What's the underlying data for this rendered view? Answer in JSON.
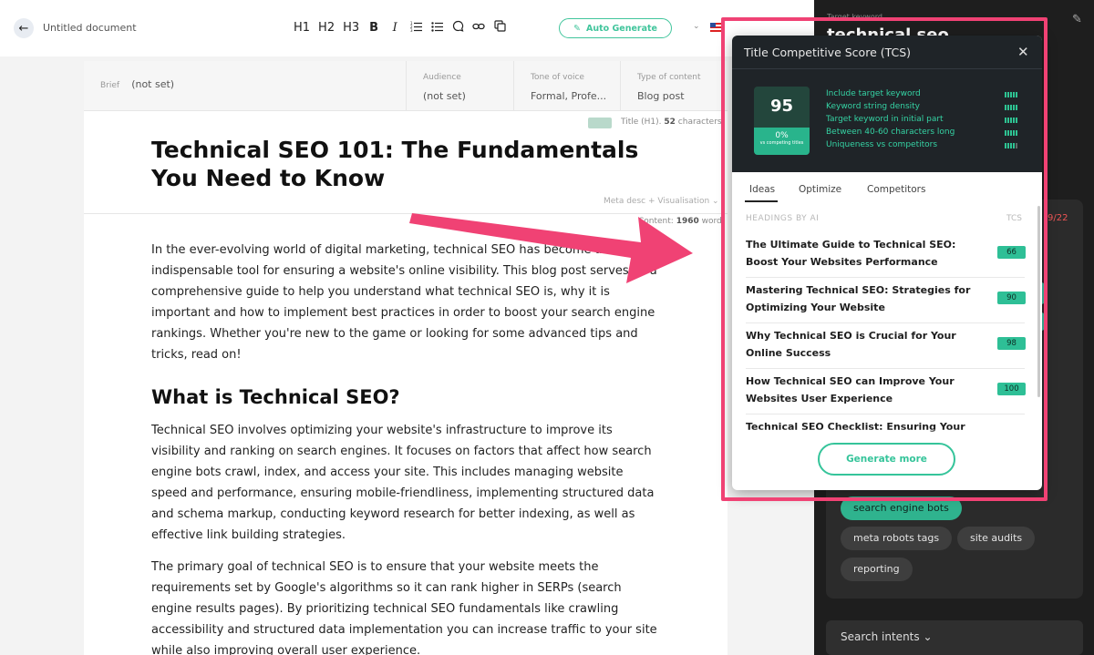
{
  "topbar": {
    "doc_title": "Untitled document",
    "tools": [
      "H1",
      "H2",
      "H3",
      "B",
      "I"
    ],
    "auto_generate": "Auto Generate"
  },
  "brief": {
    "brief_label": "Brief",
    "brief_value": "(not set)",
    "audience_label": "Audience",
    "audience_value": "(not set)",
    "tone_label": "Tone of voice",
    "tone_value": "Formal, Profe...",
    "type_label": "Type of content",
    "type_value": "Blog post"
  },
  "editor": {
    "title_meta_prefix": "Title (H1).",
    "title_meta_count": "52",
    "title_meta_suffix": " characters",
    "h1": "Technical SEO 101: The Fundamentals You Need to Know",
    "meta_desc": "Meta desc + Visualisation",
    "content_prefix": "Content:",
    "content_count": "1960",
    "content_suffix": " word",
    "p1": "In the ever-evolving world of digital marketing, technical SEO has become an indispensable tool for ensuring a website's online visibility. This blog post serves as a comprehensive guide to help you understand what technical SEO is, why it is important and how to implement best practices in order to boost your search engine rankings. Whether you're new to the game or looking for some advanced tips and tricks, read on!",
    "h2": "What is Technical SEO?",
    "p2": "Technical SEO involves optimizing your website's infrastructure to improve its visibility and ranking on search engines. It focuses on factors that affect how search engine bots crawl, index, and access your site. This includes managing website speed and performance, ensuring mobile-friendliness, implementing structured data and schema markup, conducting keyword research for better indexing, as well as effective link building strategies.",
    "p3": "The primary goal of technical SEO is to ensure that your website meets the requirements set by Google's algorithms so it can rank higher in SERPs (search engine results pages). By prioritizing technical SEO fundamentals like crawling accessibility and structured data implementation you can increase traffic to your site while also improving overall user experience."
  },
  "side_panel": {
    "target_keyword_label": "Target keyword",
    "target_keyword": "technical seo",
    "count": "9/22",
    "chips": [
      "search engine bots",
      "meta robots tags",
      "site audits",
      "reporting"
    ],
    "search_intents": "Search intents"
  },
  "tcs": {
    "title": "Title Competitive Score (TCS)",
    "score": "95",
    "score_pct": "0%",
    "score_note": "vs competing titles",
    "criteria": [
      {
        "label": "Include target keyword",
        "level": 5
      },
      {
        "label": "Keyword string density",
        "level": 5
      },
      {
        "label": "Target keyword in initial part",
        "level": 5
      },
      {
        "label": "Between 40-60 characters long",
        "level": 5
      },
      {
        "label": "Uniqueness vs competitors",
        "level": 4
      }
    ],
    "tabs": [
      "Ideas",
      "Optimize",
      "Competitors"
    ],
    "list_header": "HEADINGS BY AI",
    "list_tcs": "TCS",
    "ideas": [
      {
        "text": "The Ultimate Guide to Technical SEO: Boost Your Websites Performance",
        "score": "66"
      },
      {
        "text": "Mastering Technical SEO: Strategies for Optimizing Your Website",
        "score": "90"
      },
      {
        "text": "Why Technical SEO is Crucial for Your Online Success",
        "score": "98"
      },
      {
        "text": "How Technical SEO can Improve Your Websites User Experience",
        "score": "100"
      },
      {
        "text": "Technical SEO Checklist: Ensuring Your",
        "score": ""
      }
    ],
    "generate_more": "Generate more"
  },
  "colors": {
    "accent_green": "#35c49a",
    "highlight_pink": "#f04274",
    "dark_panel": "#1e1e1e"
  }
}
